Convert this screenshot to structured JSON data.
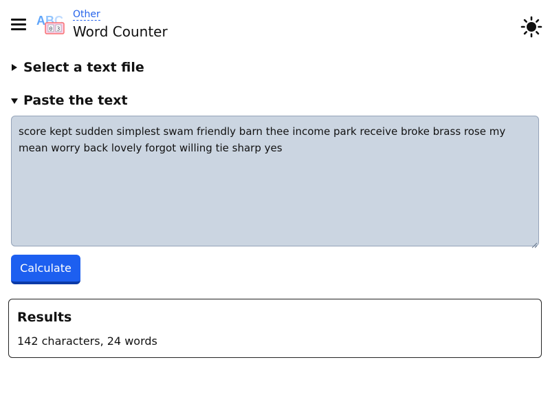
{
  "header": {
    "breadcrumb": "Other",
    "title": "Word Counter",
    "logo_letters": "ABC",
    "logo_digits": "0 3"
  },
  "sections": {
    "file_summary": "Select a text file",
    "paste_summary": "Paste the text"
  },
  "textarea": {
    "value": "score kept sudden simplest swam friendly barn thee income park receive broke brass rose my mean worry back lovely forgot willing tie sharp yes"
  },
  "actions": {
    "calculate_label": "Calculate"
  },
  "results": {
    "title": "Results",
    "value": "142 characters, 24 words"
  },
  "colors": {
    "accent": "#1d5ff0",
    "textarea_bg": "#cbd5e1",
    "link": "#2563eb"
  },
  "icons": {
    "menu": "hamburger-icon",
    "logo": "abc-counter-logo",
    "theme": "sun-icon",
    "collapsed": "triangle-right-icon",
    "expanded": "triangle-down-icon"
  }
}
